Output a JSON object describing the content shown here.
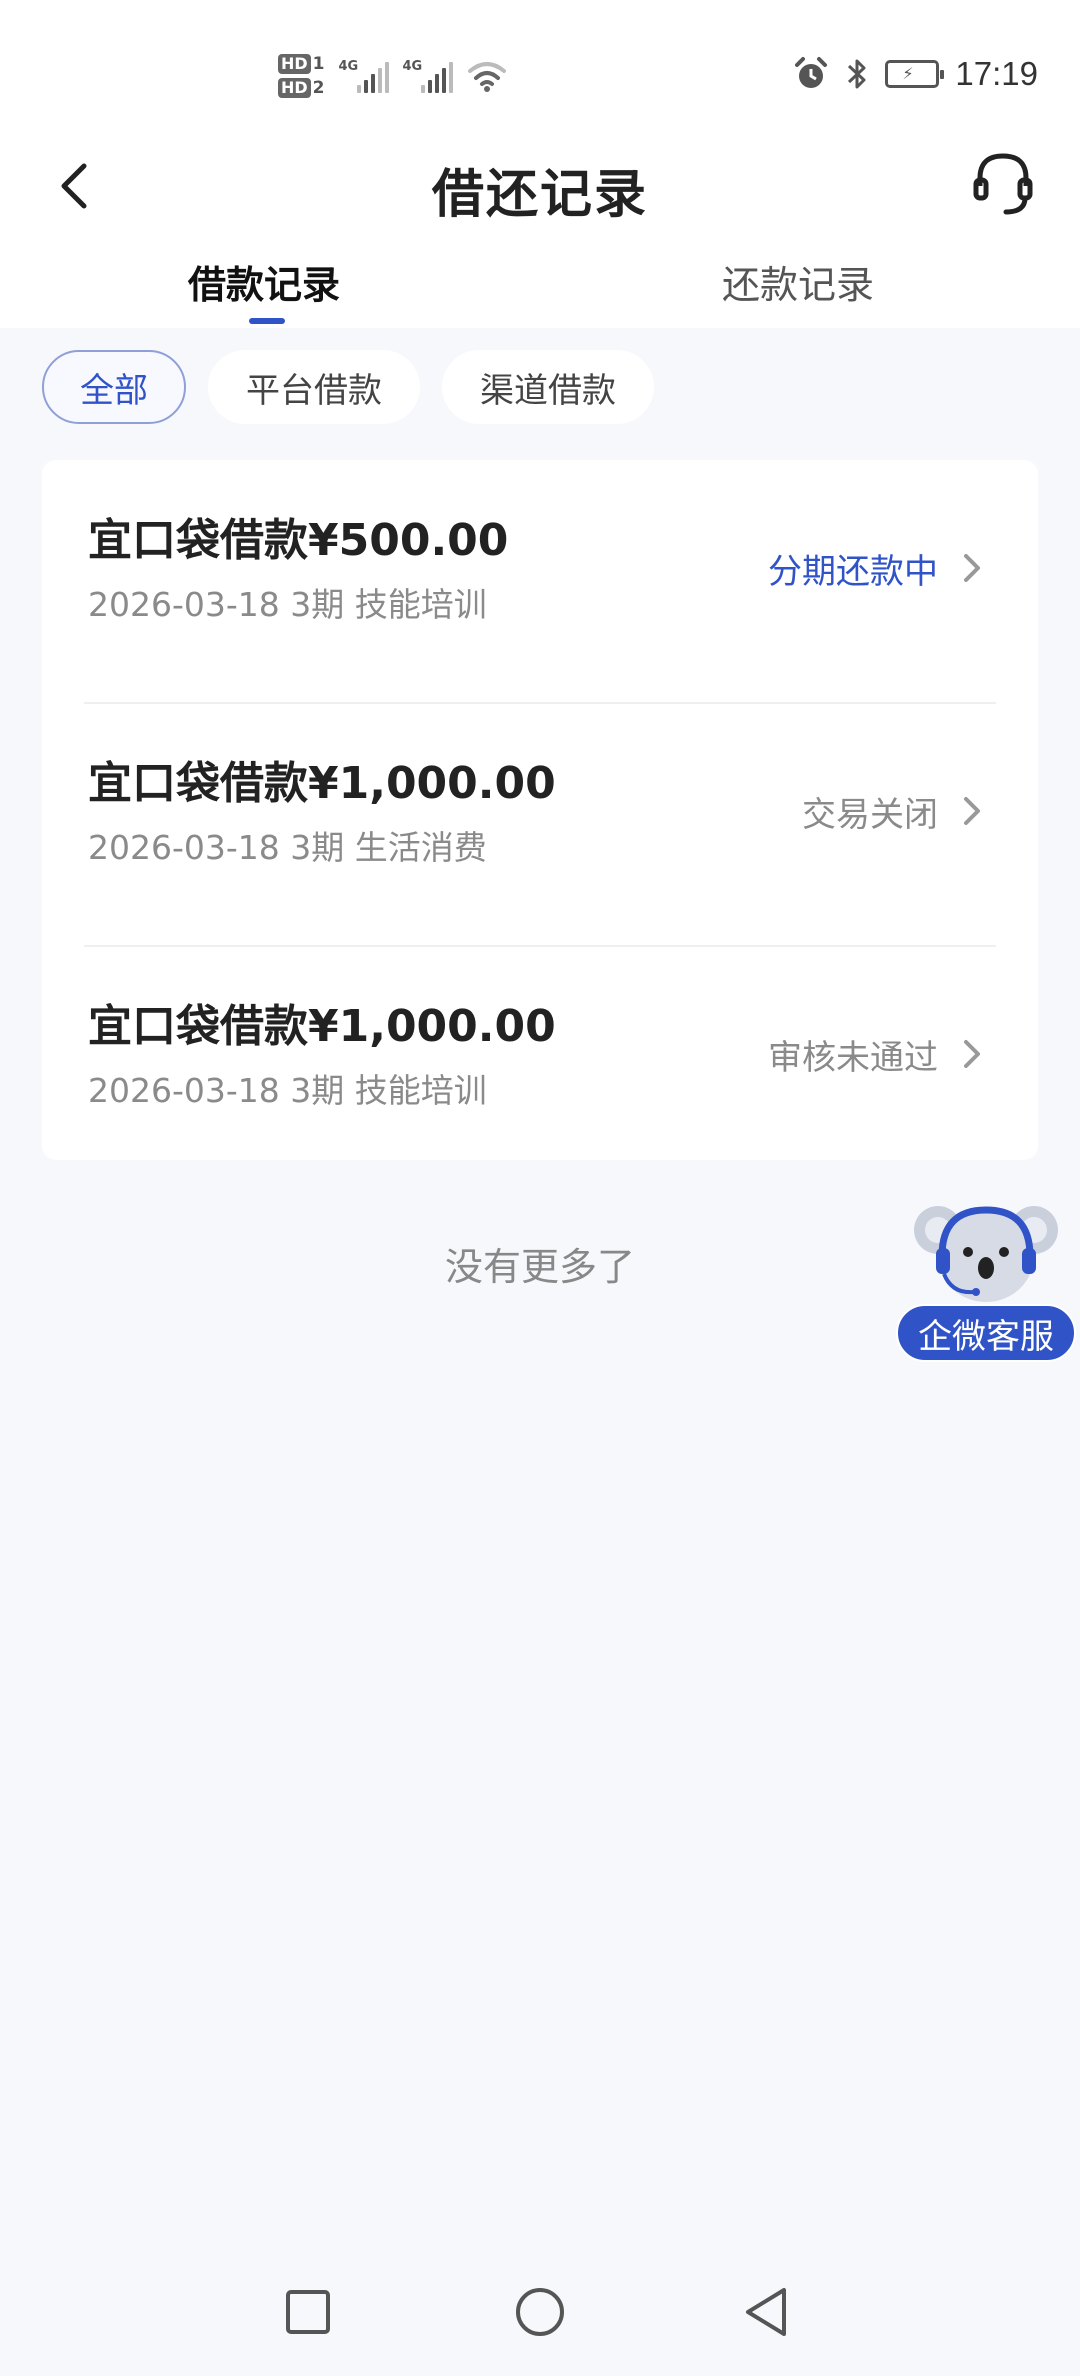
{
  "status_bar": {
    "sim1": "HD",
    "sim1_index": "1",
    "sim2": "HD",
    "sim2_index": "2",
    "network1": "4G",
    "network2": "4G",
    "icons": [
      "wifi-icon",
      "alarm-icon",
      "bluetooth-icon",
      "battery-icon"
    ],
    "time": "17:19"
  },
  "nav": {
    "title": "借还记录",
    "back_icon": "chevron-left-icon",
    "support_icon": "headset-icon"
  },
  "tabs": [
    {
      "label": "借款记录",
      "active": true
    },
    {
      "label": "还款记录",
      "active": false
    }
  ],
  "filters": [
    {
      "label": "全部",
      "active": true
    },
    {
      "label": "平台借款",
      "active": false
    },
    {
      "label": "渠道借款",
      "active": false
    }
  ],
  "records": [
    {
      "name": "宜口袋借款¥500.00",
      "meta": "2026-03-18 3期  技能培训",
      "status": "分期还款中"
    },
    {
      "name": "宜口袋借款¥1,000.00",
      "meta": "2026-03-18 3期  生活消费",
      "status": "交易关闭"
    },
    {
      "name": "宜口袋借款¥1,000.00",
      "meta": "2026-03-18 3期  技能培训",
      "status": "审核未通过"
    }
  ],
  "no_more": "没有更多了",
  "service_button": "企微客服",
  "colors": {
    "accent": "#3153c8",
    "background": "#f7f8fc",
    "muted_text": "#8a8a8a"
  }
}
